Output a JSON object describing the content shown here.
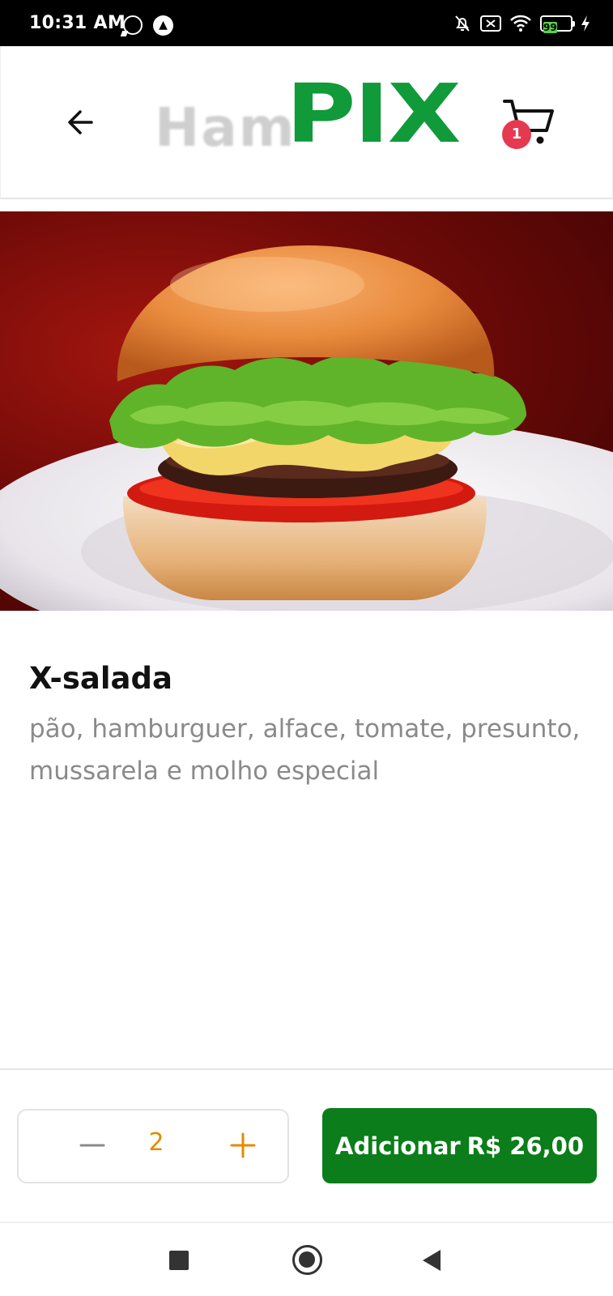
{
  "status_bar": {
    "time": "10:31 AM",
    "battery_level": "99",
    "icons": [
      "whatsapp-icon",
      "app-notification-icon",
      "bell-muted-icon",
      "sim-off-icon",
      "wifi-icon",
      "battery-icon",
      "charging-icon"
    ]
  },
  "header": {
    "logo_part1": "Ham",
    "logo_part2": "PIX",
    "cart_count": "1",
    "back_icon": "arrow-left-icon",
    "cart_icon": "shopping-cart-icon"
  },
  "colors": {
    "brand_green": "#109a3a",
    "button_green": "#0b7d1a",
    "badge_red": "#e53950",
    "qty_accent": "#e68a00"
  },
  "product": {
    "name": "X-salada",
    "description": "pão, hamburguer, alface, tomate, presunto, mussarela e molho especial"
  },
  "order": {
    "quantity": "2",
    "minus_icon": "minus-icon",
    "plus_icon": "plus-icon",
    "add_label": "Adicionar",
    "price": "R$ 26,00"
  },
  "navbar": {
    "icons": [
      "recent-apps-icon",
      "home-icon",
      "back-triangle-icon"
    ]
  }
}
